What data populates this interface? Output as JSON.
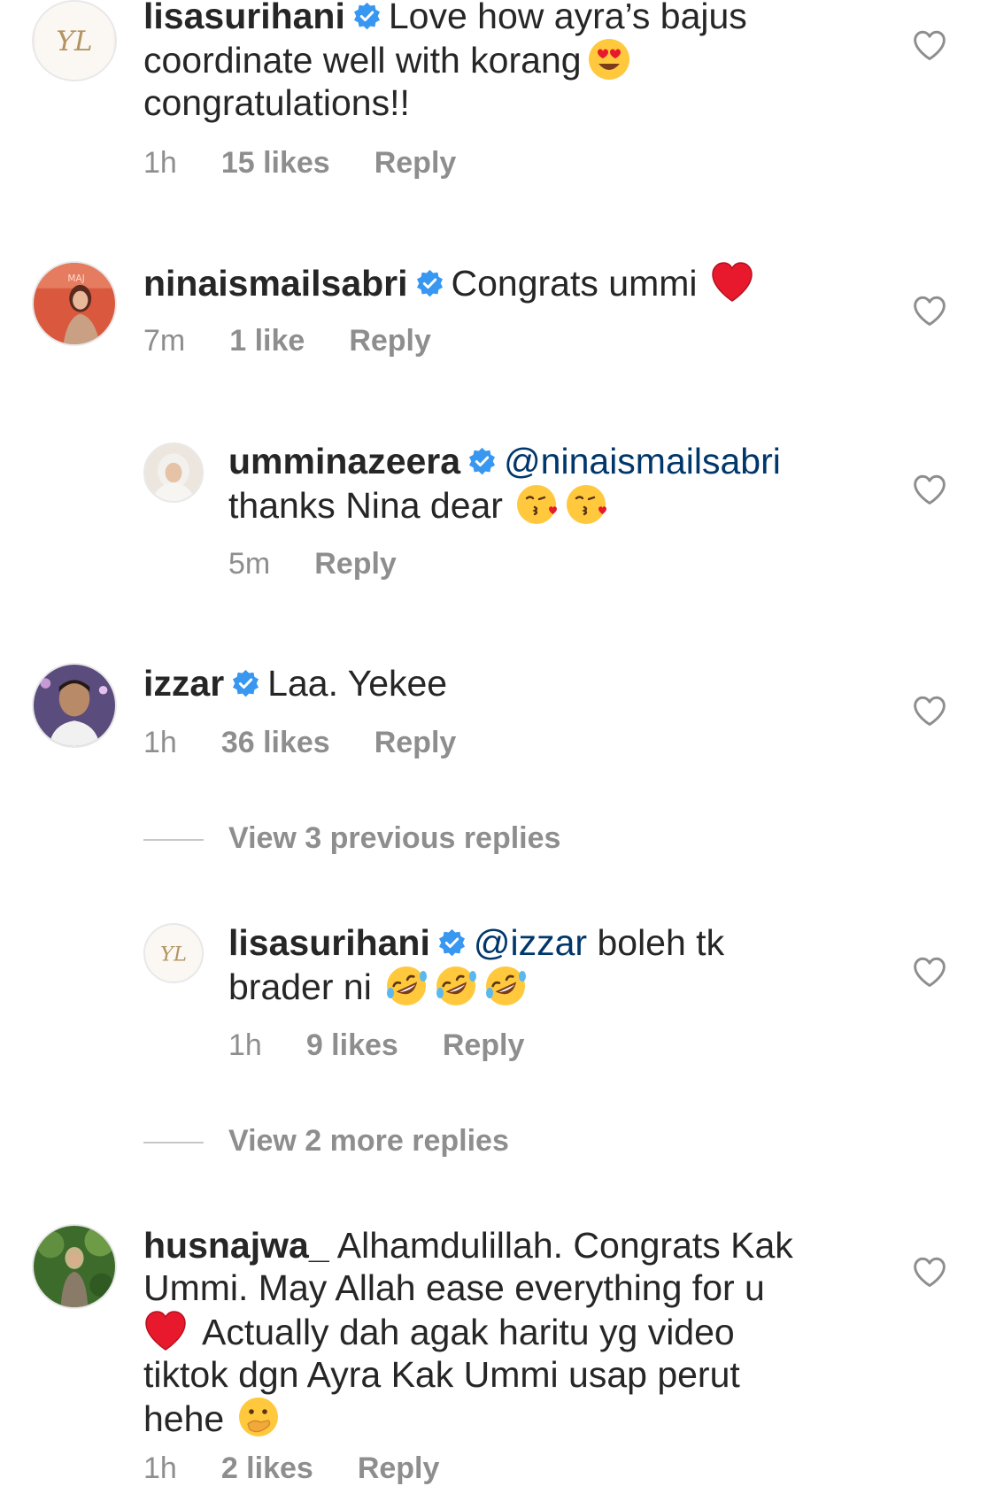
{
  "colors": {
    "text": "#262626",
    "meta": "#8e8e8e",
    "mention": "#00376b",
    "verified": "#3897f0",
    "heart_outline": "#8e8e8e"
  },
  "comments": [
    {
      "username": "lisasurihani",
      "verified": true,
      "text_lines": [
        "Love how ayra’s bajus",
        "coordinate well with korang",
        "congratulations!!"
      ],
      "emoji": [
        "heart-eyes-emoji"
      ],
      "time": "1h",
      "likes": "15 likes",
      "reply": "Reply",
      "avatar_icon": "yl-monogram-logo"
    },
    {
      "username": "ninaismailsabri",
      "verified": true,
      "text": "Congrats ummi",
      "emoji": [
        "red-heart-emoji"
      ],
      "time": "7m",
      "likes": "1 like",
      "reply": "Reply",
      "avatar_icon": "profile-photo"
    },
    {
      "username": "umminazeera",
      "verified": true,
      "mention": "@ninaismailsabri",
      "text_line2": "thanks Nina dear",
      "emoji": [
        "kissing-face-emoji",
        "kissing-face-emoji"
      ],
      "time": "5m",
      "reply": "Reply",
      "avatar_icon": "profile-photo"
    },
    {
      "username": "izzar",
      "verified": true,
      "text": "Laa. Yekee",
      "time": "1h",
      "likes": "36 likes",
      "reply": "Reply",
      "avatar_icon": "profile-photo"
    },
    {
      "username": "lisasurihani",
      "verified": true,
      "mention": "@izzar",
      "text_line1_rest": "boleh tk",
      "text_line2": "brader ni",
      "emoji": [
        "rolling-laughing-emoji",
        "rolling-laughing-emoji",
        "rolling-laughing-emoji"
      ],
      "time": "1h",
      "likes": "9 likes",
      "reply": "Reply",
      "avatar_icon": "yl-monogram-logo"
    },
    {
      "username": "husnajwa_",
      "verified": false,
      "text_lines": [
        "Alhamdulillah. Congrats Kak",
        "Ummi. May Allah ease everything for u",
        "Actually dah agak haritu yg video",
        "tiktok dgn Ayra Kak Ummi usap perut",
        "hehe"
      ],
      "emoji": [
        "red-heart-emoji",
        "hand-over-mouth-emoji"
      ],
      "time": "1h",
      "likes": "2 likes",
      "reply": "Reply",
      "avatar_icon": "profile-photo"
    }
  ],
  "view_previous_replies": "View 3 previous replies",
  "view_more_replies": "View 2 more replies",
  "avatar_logo_text": "YL"
}
